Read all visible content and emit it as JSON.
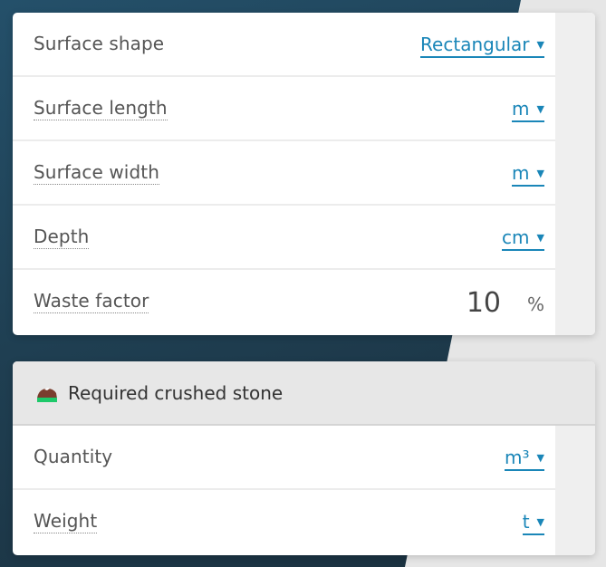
{
  "inputs": {
    "rows": [
      {
        "label": "Surface shape",
        "value": "",
        "unit": "Rectangular",
        "caret": "▼"
      },
      {
        "label": "Surface length",
        "value": "",
        "unit": "m",
        "caret": "▼"
      },
      {
        "label": "Surface width",
        "value": "",
        "unit": "m",
        "caret": "▼"
      },
      {
        "label": "Depth",
        "value": "",
        "unit": "cm",
        "caret": "▼"
      },
      {
        "label": "Waste factor",
        "value": "10",
        "unit": "%"
      }
    ]
  },
  "results": {
    "title": "Required crushed stone",
    "icon": "crushed-stone-icon",
    "rows": [
      {
        "label": "Quantity",
        "value": "",
        "unit": "m³",
        "caret": "▼"
      },
      {
        "label": "Weight",
        "value": "",
        "unit": "t",
        "caret": "▼"
      }
    ]
  },
  "colors": {
    "accent": "#1a86b8",
    "background_dark": "#1f3f52",
    "background_light": "#e6e6e6"
  }
}
